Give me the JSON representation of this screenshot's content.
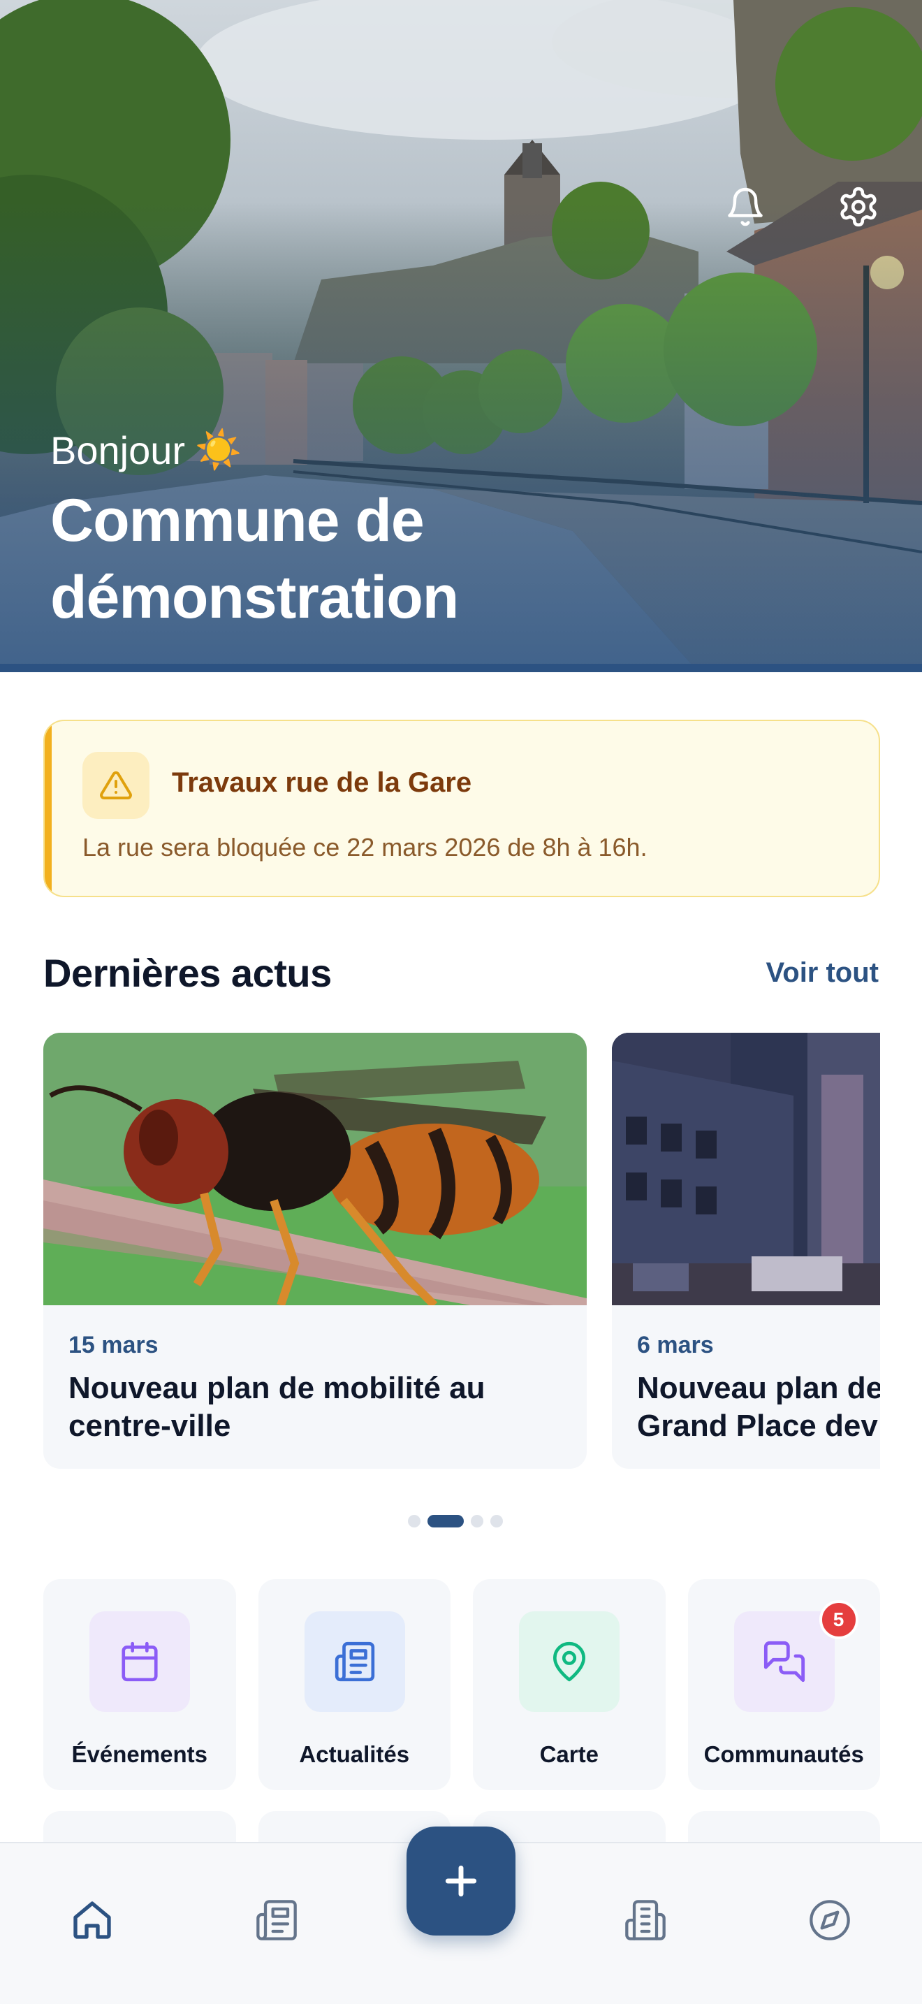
{
  "hero": {
    "greeting": "Bonjour",
    "greeting_emoji": "☀️",
    "commune_name": "Commune de démonstration",
    "actions": [
      "bell-icon",
      "gear-icon"
    ]
  },
  "alert": {
    "icon": "warning-triangle-icon",
    "title": "Travaux rue de la Gare",
    "message": "La rue sera bloquée ce 22 mars 2026 de 8h à 16h."
  },
  "news": {
    "section_title": "Dernières actus",
    "see_all_label": "Voir tout",
    "items": [
      {
        "date": "15 mars",
        "title": "Nouveau plan de mobilité au\ncentre-ville"
      },
      {
        "date": "6 mars",
        "title": "Nouveau plan de\nGrand Place dev"
      }
    ],
    "pager": {
      "count": 4,
      "active_index": 1
    }
  },
  "quick_links": [
    {
      "label": "Événements",
      "icon": "calendar-icon",
      "color": "#8b5cf6",
      "bg": "#efe9fb"
    },
    {
      "label": "Actualités",
      "icon": "newspaper-icon",
      "color": "#3b6fd6",
      "bg": "#e4ecfb"
    },
    {
      "label": "Carte",
      "icon": "map-pin-icon",
      "color": "#10b981",
      "bg": "#e2f6ee"
    },
    {
      "label": "Communautés",
      "icon": "chat-bubbles-icon",
      "color": "#8b5cf6",
      "bg": "#efe9fb",
      "badge": "5"
    }
  ],
  "bottom_nav": {
    "items": [
      "home-icon",
      "news-icon",
      "add-icon",
      "building-icon",
      "compass-icon"
    ],
    "active": "home-icon"
  },
  "colors": {
    "primary": "#2c5282",
    "alert_bg": "#fefbe8",
    "alert_accent": "#f2b01e",
    "badge": "#e53e3e"
  }
}
